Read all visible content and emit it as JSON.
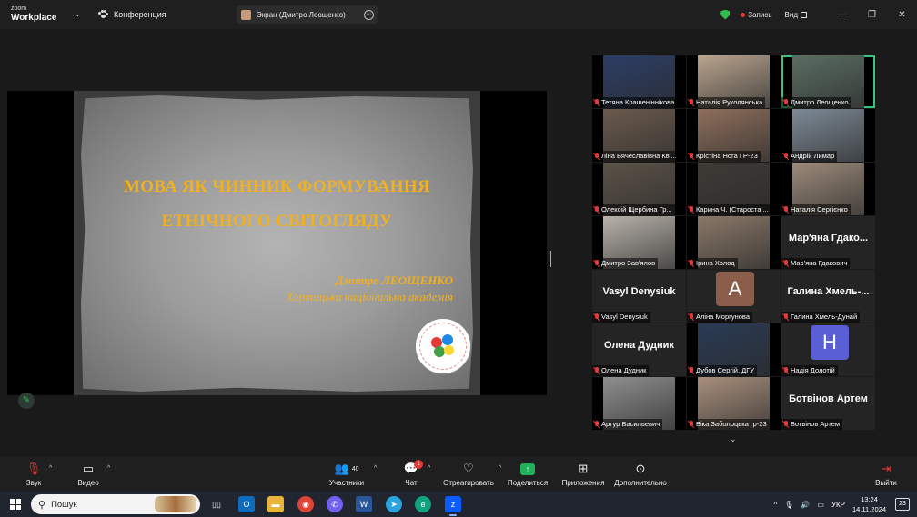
{
  "titlebar": {
    "logo_line1": "zoom",
    "logo_line2": "Workplace",
    "conference_label": "Конференция",
    "screen_pill": "Экран (Дмитро Леощенко)",
    "record_label": "Запись",
    "view_label": "Вид"
  },
  "slide": {
    "title_line1": "МОВА ЯК ЧИННИК ФОРМУВАННЯ",
    "title_line2": "ЕТНІЧНОГО СВІТОГЛЯДУ",
    "author": "Дмитро ЛЕОЩЕНКО",
    "organization": "Хортицька національна академія"
  },
  "participants": [
    {
      "name": "Тетяна Крашеніннікова",
      "type": "video",
      "color": "#2c3e66"
    },
    {
      "name": "Наталія Руколянська",
      "type": "video",
      "color": "#b9a48e"
    },
    {
      "name": "Дмитро Леощенко",
      "type": "video",
      "color": "#5a6e62",
      "active": true
    },
    {
      "name": "Ліна Вячеславівна Кві...",
      "type": "video",
      "color": "#6b5a4d"
    },
    {
      "name": "Крістіна Нога ГР-23",
      "type": "video",
      "color": "#8e6f5c"
    },
    {
      "name": "Андрій Лимар",
      "type": "video",
      "color": "#7d8a96"
    },
    {
      "name": "Олексій Щербина Гр...",
      "type": "video",
      "color": "#5c5348"
    },
    {
      "name": "Карина Ч. (Староста ...",
      "type": "video",
      "color": "#3e3a36"
    },
    {
      "name": "Наталія Сергієнко",
      "type": "video",
      "color": "#9c8a7a"
    },
    {
      "name": "Дмитро Зав'ялов",
      "type": "video",
      "color": "#b8b2aa"
    },
    {
      "name": "Ірина Холод",
      "type": "video",
      "color": "#8a7868"
    },
    {
      "name": "Мар'яна Гдакович",
      "type": "name",
      "display": "Мар'яна Гдако..."
    },
    {
      "name": "Vasyl Denysiuk",
      "type": "name",
      "display": "Vasyl Denysiuk"
    },
    {
      "name": "Аліна Моргунова",
      "type": "avatar",
      "letter": "A",
      "color": "#8b5e4c"
    },
    {
      "name": "Галина Хмель-Дунай",
      "type": "name",
      "display": "Галина Хмель-..."
    },
    {
      "name": "Олена Дудник",
      "type": "name",
      "display": "Олена Дудник"
    },
    {
      "name": "Дубов Сергій, ДГУ",
      "type": "video",
      "color": "#2a3b55"
    },
    {
      "name": "Надія Долотій",
      "type": "avatar",
      "letter": "H",
      "color": "#5b5fd6"
    },
    {
      "name": "Артур Васильевич",
      "type": "video",
      "color": "#8f8f8f"
    },
    {
      "name": "Віка Заболоцька гр-23",
      "type": "video",
      "color": "#a88f7c"
    },
    {
      "name": "Ботвінов Артем",
      "type": "name",
      "display": "Ботвінов Артем"
    }
  ],
  "toolbar": {
    "audio": "Звук",
    "video": "Видео",
    "participants": "Участники",
    "participants_count": "40",
    "chat": "Чат",
    "chat_badge": "1",
    "react": "Отреагировать",
    "share": "Поделиться",
    "apps": "Приложения",
    "more": "Дополнительно",
    "leave": "Выйти"
  },
  "taskbar": {
    "search_placeholder": "Пошук",
    "language": "УКР",
    "time": "13:24",
    "date": "14.11.2024",
    "notification_count": "23"
  }
}
